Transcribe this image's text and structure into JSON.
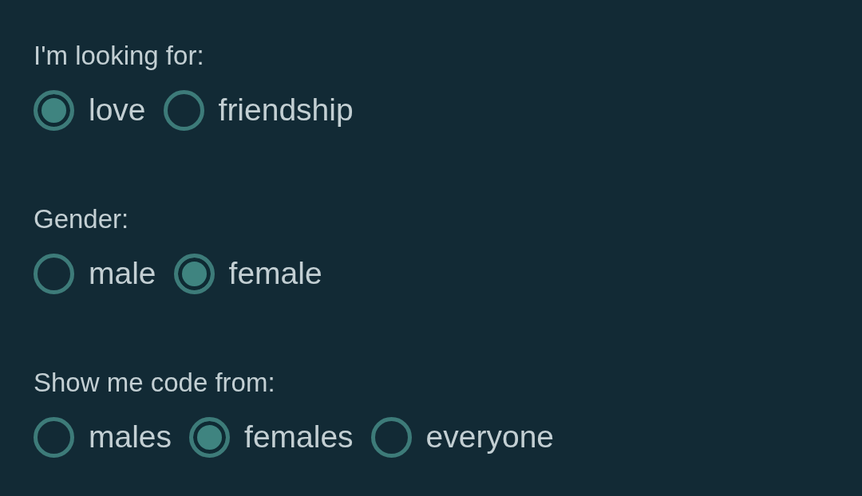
{
  "groups": [
    {
      "label": "I'm looking for:",
      "options": [
        {
          "label": "love",
          "selected": true
        },
        {
          "label": "friendship",
          "selected": false
        }
      ]
    },
    {
      "label": "Gender:",
      "options": [
        {
          "label": "male",
          "selected": false
        },
        {
          "label": "female",
          "selected": true
        }
      ]
    },
    {
      "label": "Show me code from:",
      "options": [
        {
          "label": "males",
          "selected": false
        },
        {
          "label": "females",
          "selected": true
        },
        {
          "label": "everyone",
          "selected": false
        }
      ]
    }
  ]
}
